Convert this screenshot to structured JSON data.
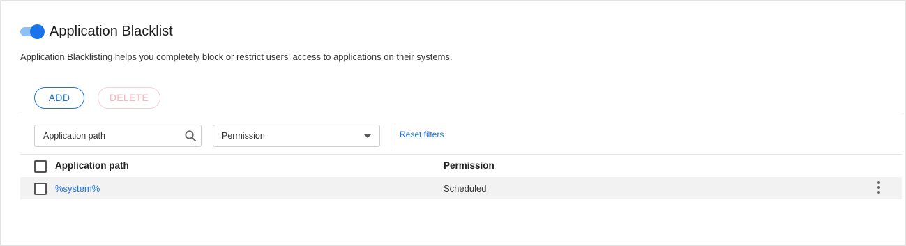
{
  "header": {
    "title": "Application Blacklist",
    "description": "Application Blacklisting helps you completely block or restrict users' access to applications on their systems.",
    "toggle_on": true
  },
  "actions": {
    "add_label": "ADD",
    "delete_label": "DELETE"
  },
  "filters": {
    "search_placeholder": "Application path",
    "permission_placeholder": "Permission",
    "reset_label": "Reset filters"
  },
  "table": {
    "columns": [
      "Application path",
      "Permission"
    ],
    "rows": [
      {
        "path": "%system%",
        "permission": "Scheduled"
      }
    ]
  },
  "colors": {
    "accent": "#1a73e8",
    "toggle_track": "#8fc0f5",
    "delete_disabled": "#f3b7bf",
    "row_bg": "#f2f2f2"
  }
}
